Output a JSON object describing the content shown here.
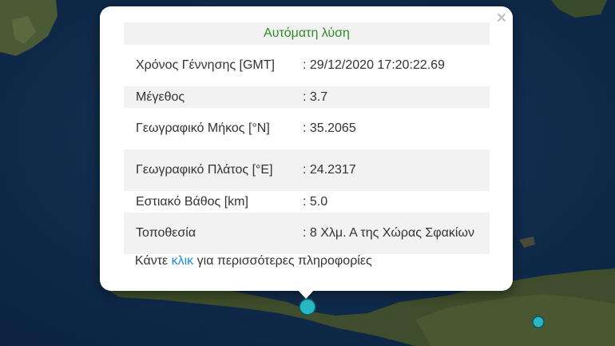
{
  "popup": {
    "title": "Αυτόματη λύση",
    "close_symbol": "×",
    "rows": [
      {
        "label": "Χρόνος Γέννησης [GMT]",
        "value": ": 29/12/2020 17:20:22.69"
      },
      {
        "label": "Μέγεθος",
        "value": ": 3.7"
      },
      {
        "label": "Γεωγραφικό Μήκος [°N]",
        "value": ": 35.2065"
      },
      {
        "label": "Γεωγραφικό Πλάτος [°E]",
        "value": ": 24.2317"
      },
      {
        "label": "Εστιακό Βάθος [km]",
        "value": ": 5.0"
      },
      {
        "label": "Τοποθεσία",
        "value": ": 8 Χλμ. Α της Χώρας Σφακίων"
      }
    ],
    "footer": {
      "before": "Κάντε ",
      "link": "κλικ",
      "after": " για περισσότερες πληροφορίες"
    }
  },
  "colors": {
    "sea": "#0f2a47",
    "land": "#3b4a2a",
    "marker": "#2ab7c4",
    "title": "#2e8b25",
    "link": "#1a8bd6"
  }
}
